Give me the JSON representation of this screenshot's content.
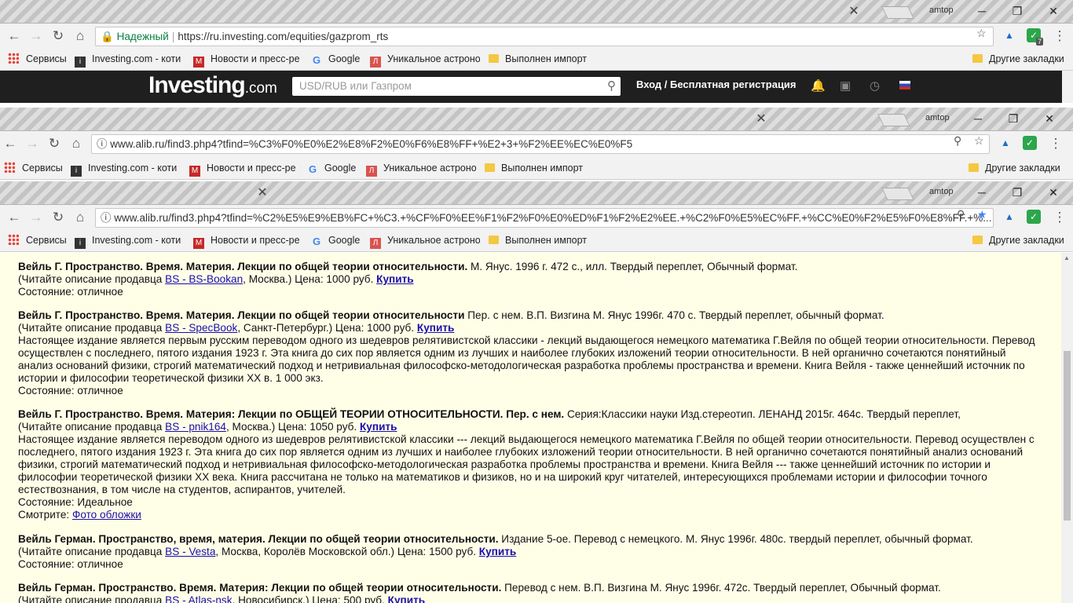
{
  "profile": "amtop",
  "window1": {
    "security_label": "Надежный",
    "url": "https://ru.investing.com/equities/gazprom_rts",
    "ext_badge": "7",
    "bookmarks": [
      "Сервисы",
      "Investing.com - коти",
      "Новости и пресс-ре",
      "Google",
      "Уникальное астроно",
      "Выполнен импорт"
    ],
    "other_bookmarks": "Другие закладки",
    "site": {
      "logo_main": "Investing",
      "logo_suffix": ".com",
      "search_placeholder": "USD/RUB или Газпром",
      "login_text": "Вход / Бесплатная регистрация"
    }
  },
  "window2": {
    "url": "www.alib.ru/find3.php4?tfind=%C3%F0%E0%E2%E8%F2%E0%F6%E8%FF+%E2+3+%F2%EE%EC%E0%F5",
    "bookmarks": [
      "Сервисы",
      "Investing.com - коти",
      "Новости и пресс-ре",
      "Google",
      "Уникальное астроно",
      "Выполнен импорт"
    ],
    "other_bookmarks": "Другие закладки"
  },
  "window3": {
    "url": "www.alib.ru/find3.php4?tfind=%C2%E5%E9%EB%FC+%C3.+%CF%F0%EE%F1%F2%F0%E0%ED%F1%F2%E2%EE.+%C2%F0%E5%EC%FF.+%CC%E0%F2%E5%F0%E8%FF.+%...",
    "bookmarks": [
      "Сервисы",
      "Investing.com - коти",
      "Новости и пресс-ре",
      "Google",
      "Уникальное астроно",
      "Выполнен импорт"
    ],
    "other_bookmarks": "Другие закладки"
  },
  "entries": [
    {
      "title": "Вейль Г. Пространство. Время. Материя. Лекции по общей теории относительности.",
      "details": " М. Янус. 1996 г. 472 с., илл. Твердый переплет, Обычный формат.",
      "seller_prefix": "(Читайте описание продавца ",
      "seller": "BS - BS-Bookan",
      "seller_suffix": ", Москва.) Цена: 1000 руб. ",
      "buy": "Купить",
      "description": "",
      "condition": "Состояние: отличное"
    },
    {
      "title": "Вейль Г. Пространство. Время. Материя. Лекции по общей теории относительности",
      "details": " Пер. с нем. В.П. Визгина М. Янус 1996г. 470 с. Твердый переплет, обычный формат.",
      "seller_prefix": "(Читайте описание продавца ",
      "seller": "BS - SpecBook",
      "seller_suffix": ", Санкт-Петербург.) Цена: 1000 руб. ",
      "buy": "Купить",
      "description": "Настоящее издание является первым русским переводом одного из шедевров релятивистской классики - лекций выдающегося немецкого математика Г.Вейля по общей теории относительности. Перевод осуществлен с последнего, пятого издания 1923 г. Эта книга до сих пор является одним из лучших и наиболее глубоких изложений теории относительности. В ней органично сочетаются понятийный анализ оснований физики, строгий математический подход и нетривиальная философско-методологическая разработка проблемы пространства и времени. Книга Вейля - также ценнейший источник по истории и философии теоретической физики XX в. 1 000 экз.",
      "condition": "Состояние: отличное"
    },
    {
      "title": "Вейль Г. Пространство. Время. Материя: Лекции по ОБЩЕЙ ТЕОРИИ ОТНОСИТЕЛЬНОСТИ. Пер. с нем.",
      "details": " Серия:Классики науки Изд.стереотип. ЛЕНАНД 2015г. 464с. Твердый переплет,",
      "seller_prefix": "(Читайте описание продавца ",
      "seller": "BS - pnik164",
      "seller_suffix": ", Москва.) Цена: 1050 руб. ",
      "buy": "Купить",
      "description": "Настоящее издание является переводом одного из шедевров релятивистской классики --- лекций выдающегося немецкого математика Г.Вейля по общей теории относительности. Перевод осуществлен с последнего, пятого издания 1923 г. Эта книга до сих пор является одним из лучших и наиболее глубоких изложений теории относительности. В ней органично сочетаются понятийный анализ оснований физики, строгий математический подход и нетривиальная философско-методологическая разработка проблемы пространства и времени. Книга Вейля --- также ценнейший источник по истории и философии теоретической физики XX века. Книга рассчитана не только на математиков и физиков, но и на широкий круг читателей, интересующихся проблемами истории и философии точного естествознания, в том числе на студентов, аспирантов, учителей.",
      "condition": "Состояние: Идеальное",
      "see_prefix": "Смотрите: ",
      "see_link": "Фото обложки"
    },
    {
      "title": "Вейль Герман. Пространство, время, материя. Лекции по общей теории относительности.",
      "details": " Издание 5-ое. Перевод с немецкого. М. Янус 1996г. 480с. твердый переплет, обычный формат.",
      "seller_prefix": "(Читайте описание продавца ",
      "seller": "BS - Vesta",
      "seller_suffix": ", Москва, Королёв Московской обл.) Цена: 1500 руб. ",
      "buy": "Купить",
      "description": "",
      "condition": "Состояние: отличное"
    },
    {
      "title": "Вейль Герман. Пространство. Время. Материя: Лекции по общей теории относительности.",
      "details": " Перевод с нем. В.П. Визгина М. Янус 1996г. 472с. Твердый переплет, Обычный формат.",
      "seller_prefix": "(Читайте описание продавца ",
      "seller": "BS - Atlas-nsk",
      "seller_suffix": ", Новосибирск.) Цена: 500 руб. ",
      "buy": "Купить",
      "description": "",
      "condition": ""
    }
  ]
}
